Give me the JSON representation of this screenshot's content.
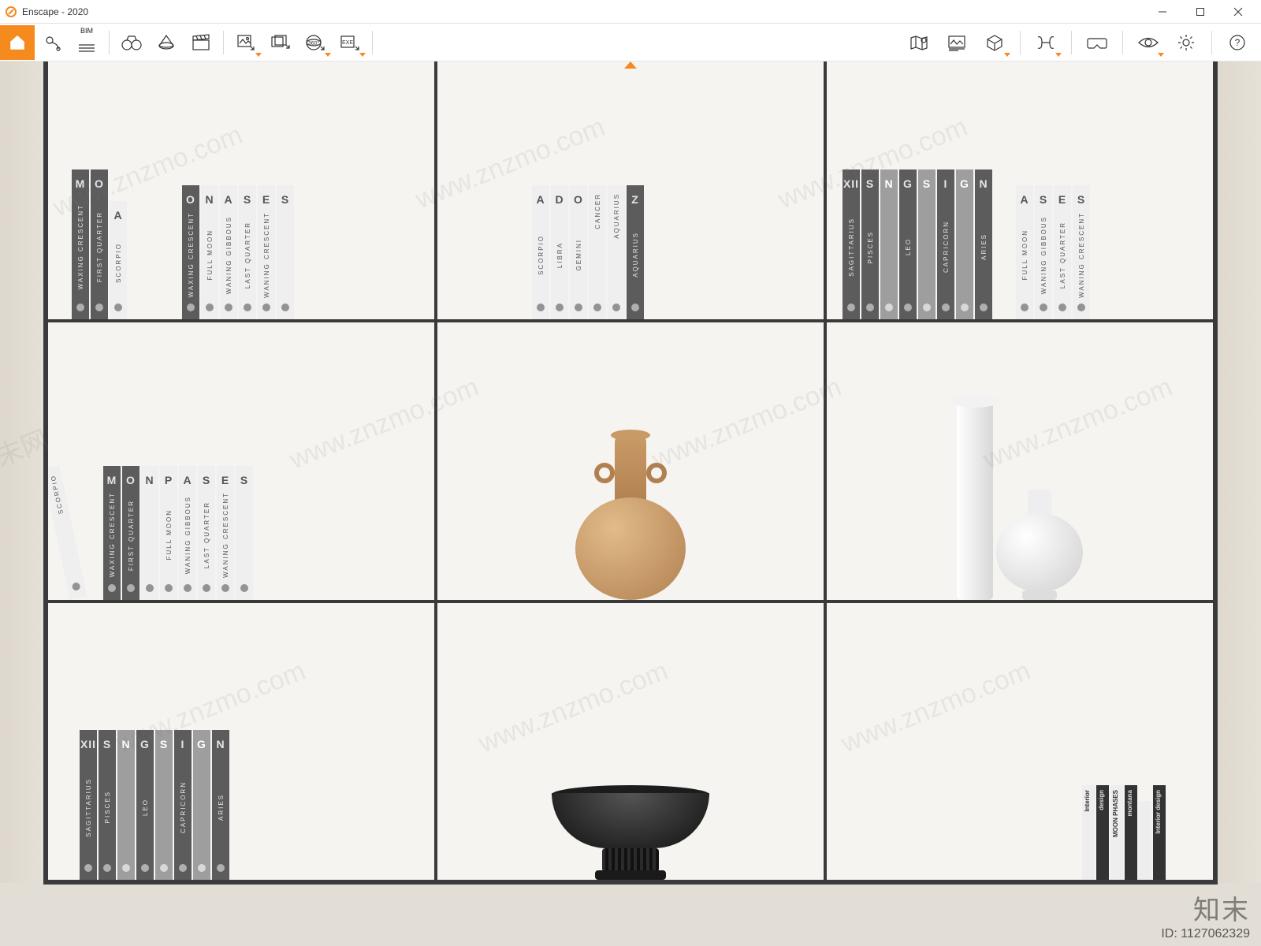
{
  "window": {
    "title": "Enscape - 2020",
    "controls": {
      "min": "minimize",
      "max": "maximize",
      "close": "close"
    }
  },
  "toolbar": {
    "left": [
      "home",
      "pin",
      "bim-menu",
      "binoculars",
      "view-cone",
      "clapper",
      "sep",
      "export-image",
      "export-batch",
      "export-360",
      "export-exe",
      "sep"
    ],
    "right": [
      "map",
      "manage-views",
      "cube",
      "sep",
      "compare",
      "sep",
      "vr",
      "sep",
      "visual-style",
      "settings",
      "sep",
      "help"
    ],
    "bim_label": "BIM"
  },
  "scene": {
    "shelves": {
      "r1c1": {
        "group1": [
          "M",
          "O",
          "A"
        ],
        "group2": [
          "O",
          "N",
          "A",
          "S",
          "E",
          "S"
        ],
        "spines1": [
          "WAXING CRESCENT",
          "FIRST QUARTER",
          "SCORPIO"
        ],
        "spines2": [
          "WAXING CRESCENT",
          "FULL MOON",
          "WANING GIBBOUS",
          "LAST QUARTER",
          "WANING CRESCENT"
        ]
      },
      "r1c2": {
        "caps": [
          "A",
          "D",
          "O",
          "Z"
        ],
        "spines": [
          "SCORPIO",
          "LIBRA",
          "GEMINI",
          "CANCER",
          "AQUARIUS",
          "AQUARIUS"
        ]
      },
      "r1c3": {
        "group1": [
          "XII",
          "S",
          "N",
          "G",
          "S",
          "I",
          "G",
          "N"
        ],
        "group2": [
          "A",
          "S",
          "E",
          "S"
        ],
        "spines1": [
          "SAGITTARIUS",
          "PISCES",
          "LEO",
          "CAPRICORN",
          "ARIES"
        ],
        "spines2": [
          "FULL MOON",
          "WANING GIBBOUS",
          "LAST QUARTER",
          "WANING CRESCENT"
        ]
      },
      "r2c1": {
        "lean": "SCORPIO",
        "caps": [
          "M",
          "O",
          "N",
          "P",
          "A",
          "S",
          "E",
          "S"
        ],
        "spines": [
          "WAXING CRESCENT",
          "FIRST QUARTER",
          "FULL MOON",
          "WANING GIBBOUS",
          "LAST QUARTER",
          "WANING CRESCENT"
        ]
      },
      "r3c1": {
        "caps": [
          "XII",
          "S",
          "N",
          "G",
          "S",
          "I",
          "G",
          "N"
        ],
        "spines": [
          "SAGITTARIUS",
          "PISCES",
          "LEO",
          "CAPRICORN",
          "ARIES"
        ]
      },
      "r3c3": {
        "titles": [
          "Interior",
          "design",
          "MOON PHASES",
          "montana",
          "Interior design"
        ]
      }
    }
  },
  "watermark": {
    "text": "www.znzmo.com",
    "cn": "知末网",
    "brand": "知末",
    "id_label": "ID: 1127062329"
  }
}
